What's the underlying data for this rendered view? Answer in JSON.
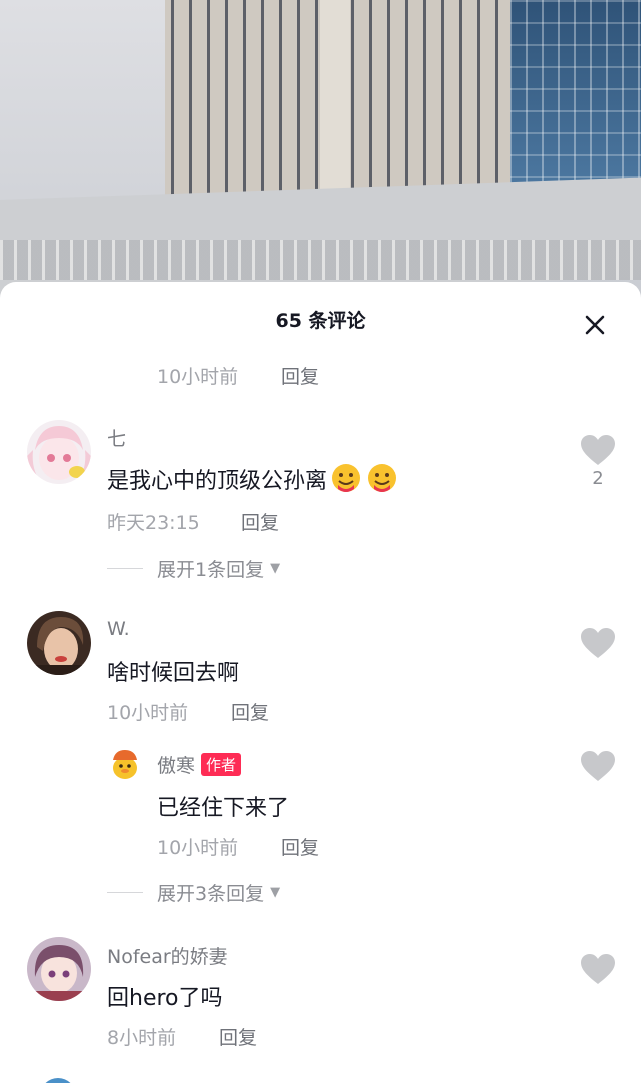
{
  "sheet": {
    "title": "65 条评论"
  },
  "top_partial": {
    "time": "10小时前",
    "reply": "回复"
  },
  "comments": [
    {
      "username": "七",
      "text": "是我心中的顶级公孙离",
      "emoji": [
        "hug-emoji",
        "hug-emoji"
      ],
      "time": "昨天23:15",
      "reply": "回复",
      "likes": "2",
      "expand": "展开1条回复"
    },
    {
      "username": "W.",
      "text": "啥时候回去啊",
      "time": "10小时前",
      "reply": "回复",
      "sub_reply": {
        "username": "傲寒",
        "badge": "作者",
        "text": "已经住下来了",
        "time": "10小时前",
        "reply": "回复"
      },
      "expand": "展开3条回复"
    },
    {
      "username": "Nofear的娇妻",
      "text": "回hero了吗",
      "time": "8小时前",
      "reply": "回复"
    }
  ],
  "colors": {
    "accent": "#fe2c55",
    "heart": "#c7c8cb",
    "text": "#161823"
  }
}
